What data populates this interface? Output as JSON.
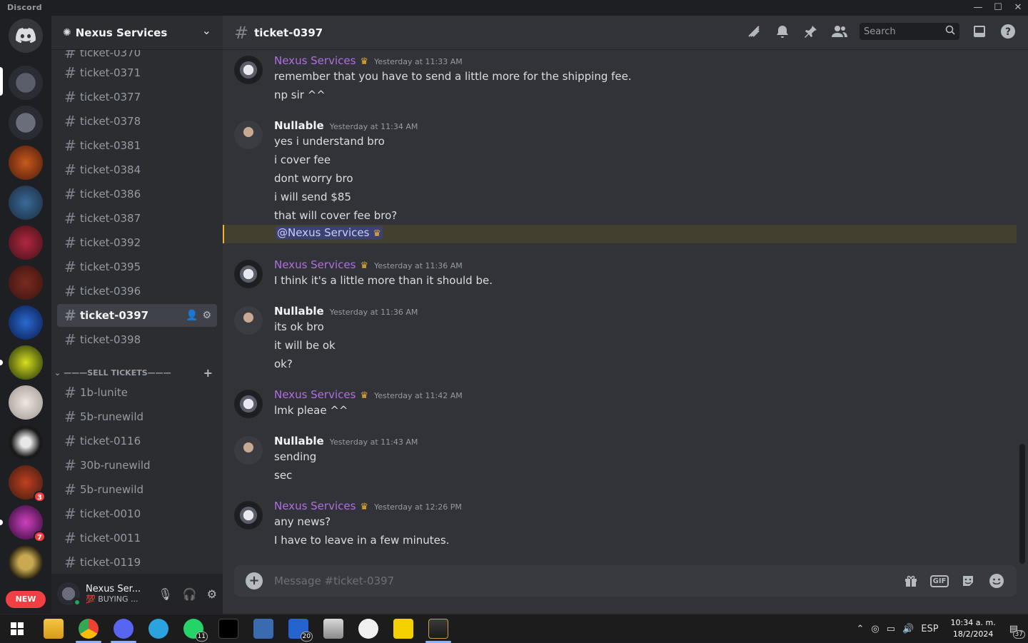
{
  "window": {
    "app_name": "Discord",
    "minimize": "—",
    "maximize": "☐",
    "close": "✕"
  },
  "servers": {
    "badges": [
      "3",
      "7"
    ],
    "new_label": "NEW"
  },
  "guild": {
    "name": "Nexus Services",
    "chevron": "⌄"
  },
  "channels": {
    "top_partial": "ticket-0370",
    "items": [
      "ticket-0371",
      "ticket-0377",
      "ticket-0378",
      "ticket-0381",
      "ticket-0384",
      "ticket-0386",
      "ticket-0387",
      "ticket-0392",
      "ticket-0395",
      "ticket-0396",
      "ticket-0397",
      "ticket-0398"
    ],
    "active": "ticket-0397",
    "category": "———SELL TICKETS———",
    "category_items": [
      "1b-lunite",
      "5b-runewild",
      "ticket-0116",
      "30b-runewild",
      "5b-runewild",
      "ticket-0010",
      "ticket-0011",
      "ticket-0119"
    ]
  },
  "user_panel": {
    "name": "Nexus Ser...",
    "status": "💯 BUYING ..."
  },
  "chat": {
    "channel_name": "ticket-0397",
    "search_placeholder": "Search",
    "composer_placeholder": "Message #ticket-0397",
    "gif_label": "GIF"
  },
  "messages": [
    {
      "author": "Nexus Services",
      "timestamp": "Yesterday at 11:33 AM",
      "lines": [
        "remember that you have to send a little more for the shipping fee.",
        "np sir ^^"
      ]
    },
    {
      "author": "Nullable",
      "timestamp": "Yesterday at 11:34 AM",
      "lines": [
        "yes i understand bro",
        "i cover fee",
        "dont worry bro",
        "i will send $85",
        "that will cover fee bro?"
      ],
      "mention": "@Nexus Services"
    },
    {
      "author": "Nexus Services",
      "timestamp": "Yesterday at 11:36 AM",
      "lines": [
        "I think it's a little more than it should be."
      ]
    },
    {
      "author": "Nullable",
      "timestamp": "Yesterday at 11:36 AM",
      "lines": [
        "its ok bro",
        "it will be ok",
        "ok?"
      ]
    },
    {
      "author": "Nexus Services",
      "timestamp": "Yesterday at 11:42 AM",
      "lines": [
        "lmk pleae ^^"
      ]
    },
    {
      "author": "Nullable",
      "timestamp": "Yesterday at 11:43 AM",
      "lines": [
        "sending",
        "sec"
      ]
    },
    {
      "author": "Nexus Services",
      "timestamp": "Yesterday at 12:26 PM",
      "lines": [
        "any news?",
        "I have to leave in a few minutes."
      ]
    }
  ],
  "taskbar": {
    "whatsapp_badge": "11",
    "todo_badge": "20",
    "lang": "ESP",
    "time": "10:34 a. m.",
    "date": "18/2/2024",
    "notif_count": "37"
  },
  "colors": {
    "nexus_name": "#b26ee0",
    "mention_bg": "#43402f",
    "accent": "#5865f2"
  }
}
